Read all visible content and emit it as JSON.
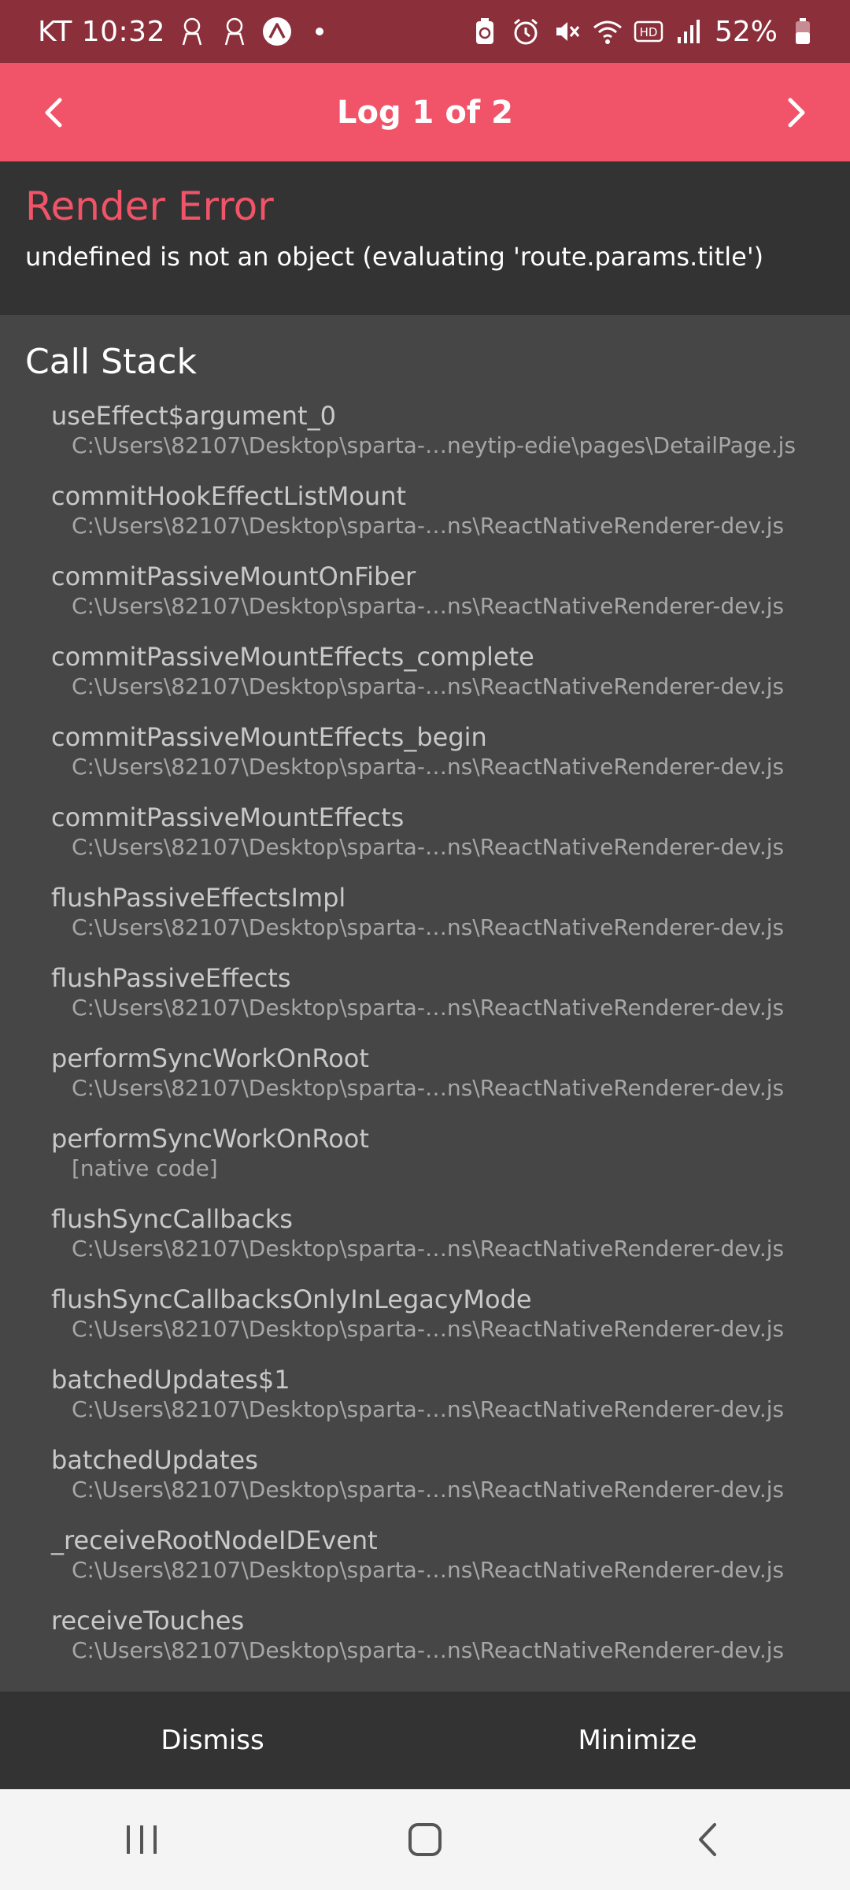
{
  "status_bar": {
    "time": "KT 10:32",
    "battery": "52%",
    "icons": [
      "notification-avatar-icon",
      "notification-avatar-icon",
      "expo-icon",
      "dot-icon",
      "battery-saver-icon",
      "alarm-icon",
      "mute-icon",
      "wifi-icon",
      "hd-icon",
      "signal-icon",
      "battery-icon"
    ]
  },
  "header": {
    "title": "Log 1 of 2",
    "prev_icon": "chevron-left-icon",
    "next_icon": "chevron-right-icon",
    "color": "#f15468"
  },
  "error": {
    "title": "Render Error",
    "message": "undefined is not an object (evaluating 'route.params.title')",
    "title_color": "#f15468"
  },
  "call_stack": {
    "heading": "Call Stack",
    "frames": [
      {
        "method": "useEffect$argument_0",
        "file": "C:\\Users\\82107\\Desktop\\sparta-…neytip-edie\\pages\\DetailPage.js"
      },
      {
        "method": "commitHookEffectListMount",
        "file": "C:\\Users\\82107\\Desktop\\sparta-…ns\\ReactNativeRenderer-dev.js"
      },
      {
        "method": "commitPassiveMountOnFiber",
        "file": "C:\\Users\\82107\\Desktop\\sparta-…ns\\ReactNativeRenderer-dev.js"
      },
      {
        "method": "commitPassiveMountEffects_complete",
        "file": "C:\\Users\\82107\\Desktop\\sparta-…ns\\ReactNativeRenderer-dev.js"
      },
      {
        "method": "commitPassiveMountEffects_begin",
        "file": "C:\\Users\\82107\\Desktop\\sparta-…ns\\ReactNativeRenderer-dev.js"
      },
      {
        "method": "commitPassiveMountEffects",
        "file": "C:\\Users\\82107\\Desktop\\sparta-…ns\\ReactNativeRenderer-dev.js"
      },
      {
        "method": "flushPassiveEffectsImpl",
        "file": "C:\\Users\\82107\\Desktop\\sparta-…ns\\ReactNativeRenderer-dev.js"
      },
      {
        "method": "flushPassiveEffects",
        "file": "C:\\Users\\82107\\Desktop\\sparta-…ns\\ReactNativeRenderer-dev.js"
      },
      {
        "method": "performSyncWorkOnRoot",
        "file": "C:\\Users\\82107\\Desktop\\sparta-…ns\\ReactNativeRenderer-dev.js"
      },
      {
        "method": "performSyncWorkOnRoot",
        "file": "[native code]"
      },
      {
        "method": "flushSyncCallbacks",
        "file": "C:\\Users\\82107\\Desktop\\sparta-…ns\\ReactNativeRenderer-dev.js"
      },
      {
        "method": "flushSyncCallbacksOnlyInLegacyMode",
        "file": "C:\\Users\\82107\\Desktop\\sparta-…ns\\ReactNativeRenderer-dev.js"
      },
      {
        "method": "batchedUpdates$1",
        "file": "C:\\Users\\82107\\Desktop\\sparta-…ns\\ReactNativeRenderer-dev.js"
      },
      {
        "method": "batchedUpdates",
        "file": "C:\\Users\\82107\\Desktop\\sparta-…ns\\ReactNativeRenderer-dev.js"
      },
      {
        "method": "_receiveRootNodeIDEvent",
        "file": "C:\\Users\\82107\\Desktop\\sparta-…ns\\ReactNativeRenderer-dev.js"
      },
      {
        "method": "receiveTouches",
        "file": "C:\\Users\\82107\\Desktop\\sparta-…ns\\ReactNativeRenderer-dev.js"
      }
    ]
  },
  "actions": {
    "dismiss": "Dismiss",
    "minimize": "Minimize"
  },
  "nav_bar": {
    "icons": [
      "recent-apps-icon",
      "home-icon",
      "back-icon"
    ]
  }
}
